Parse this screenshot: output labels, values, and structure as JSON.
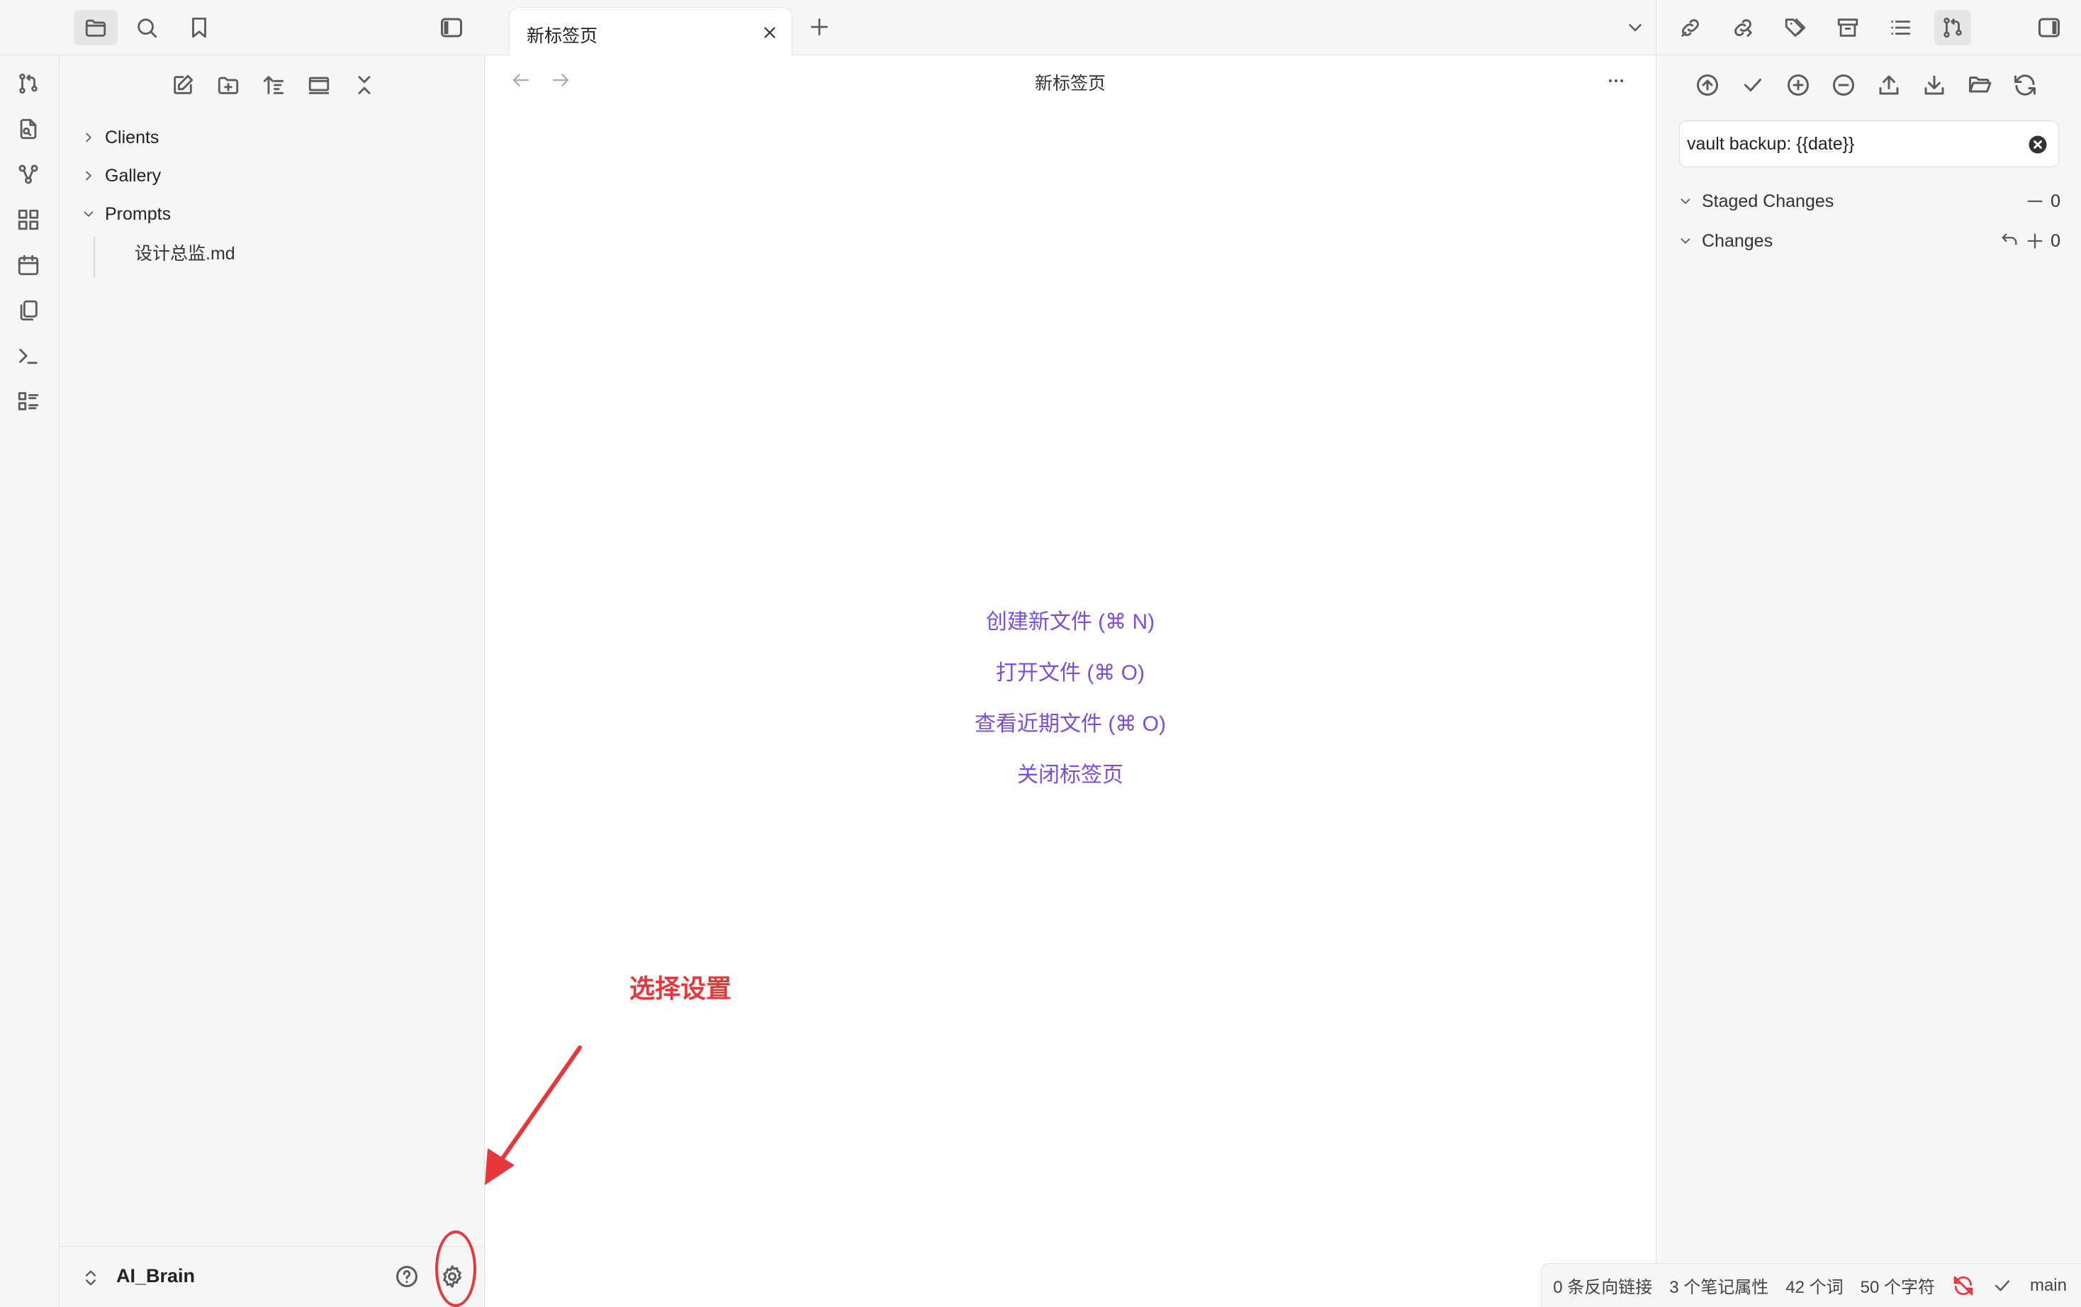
{
  "left_topbar": {
    "icons": [
      "folder-icon",
      "search-icon",
      "bookmark-icon",
      "sidebar-toggle-icon"
    ]
  },
  "file_explorer": {
    "actions": [
      "new-note-icon",
      "new-folder-icon",
      "sort-icon",
      "auto-reveal-icon",
      "collapse-all-icon"
    ],
    "items": [
      {
        "label": "Clients",
        "type": "folder",
        "expanded": false
      },
      {
        "label": "Gallery",
        "type": "folder",
        "expanded": false
      },
      {
        "label": "Prompts",
        "type": "folder",
        "expanded": true
      },
      {
        "label": "设计总监.md",
        "type": "file",
        "parent": "Prompts"
      }
    ]
  },
  "ribbon": {
    "icons": [
      "git-branch-icon",
      "file-search-icon",
      "graph-icon",
      "grid-icon",
      "calendar-icon",
      "copy-icon",
      "terminal-icon",
      "list-icon"
    ]
  },
  "vault": {
    "name": "AI_Brain"
  },
  "tab": {
    "title": "新标签页"
  },
  "editor": {
    "view_title": "新标签页",
    "actions": {
      "create": "创建新文件 (⌘ N)",
      "open": "打开文件 (⌘ O)",
      "recent": "查看近期文件 (⌘ O)",
      "close": "关闭标签页"
    }
  },
  "annotation": {
    "text": "选择设置",
    "color": "#e8373c"
  },
  "git": {
    "commit_message": "vault backup: {{date}}",
    "staged": {
      "label": "Staged Changes",
      "count": "0"
    },
    "changes": {
      "label": "Changes",
      "count": "0"
    }
  },
  "status_bar": {
    "backlinks": "0 条反向链接",
    "properties": "3 个笔记属性",
    "words": "42 个词",
    "chars": "50 个字符",
    "branch": "main"
  },
  "colors": {
    "accent": "#7c4ddc",
    "annotation": "#e8373c",
    "sidebar_bg": "#f6f6f6"
  }
}
